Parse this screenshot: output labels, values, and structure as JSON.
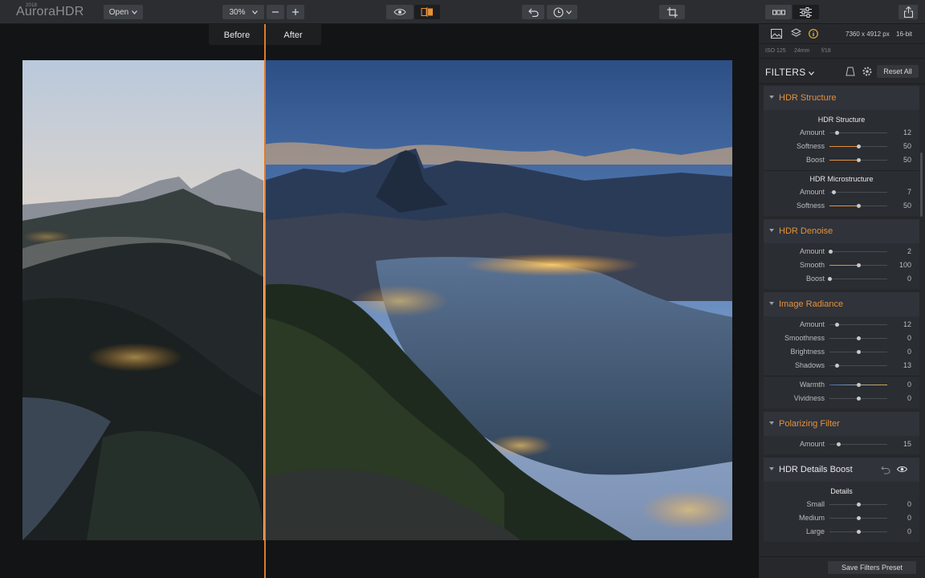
{
  "app": {
    "logo_text": "AuroraHDR",
    "logo_year": "2018"
  },
  "toolbar": {
    "open_label": "Open",
    "zoom_value": "30%",
    "zoom_out_icon": "minus-icon",
    "zoom_in_icon": "plus-icon"
  },
  "canvas": {
    "before_label": "Before",
    "after_label": "After"
  },
  "info": {
    "dimensions": "7360 x 4912 px",
    "bit_depth": "16-bit",
    "iso": "ISO 125",
    "focal": "24mm",
    "aperture": "f/18"
  },
  "filters": {
    "title": "FILTERS",
    "reset_label": "Reset All",
    "save_preset_label": "Save Filters Preset",
    "accent": "#e5913a",
    "sections": [
      {
        "title": "HDR Structure",
        "groups": [
          {
            "subtitle": "HDR Structure",
            "sliders": [
              {
                "label": "Amount",
                "value": "12",
                "pos": 0.12,
                "fill": false
              },
              {
                "label": "Softness",
                "value": "50",
                "pos": 0.5,
                "fill": true
              },
              {
                "label": "Boost",
                "value": "50",
                "pos": 0.5,
                "fill": true
              }
            ]
          },
          {
            "subtitle": "HDR Microstructure",
            "sliders": [
              {
                "label": "Amount",
                "value": "7",
                "pos": 0.07,
                "fill": false
              },
              {
                "label": "Softness",
                "value": "50",
                "pos": 0.5,
                "fill": true
              }
            ]
          }
        ]
      },
      {
        "title": "HDR Denoise",
        "groups": [
          {
            "subtitle": "",
            "sliders": [
              {
                "label": "Amount",
                "value": "2",
                "pos": 0.02,
                "fill": false
              },
              {
                "label": "Smooth",
                "value": "100",
                "pos": 0.5,
                "fill": true
              },
              {
                "label": "Boost",
                "value": "0",
                "pos": 0.0,
                "fill": false
              }
            ]
          }
        ]
      },
      {
        "title": "Image Radiance",
        "groups": [
          {
            "subtitle": "",
            "sliders": [
              {
                "label": "Amount",
                "value": "12",
                "pos": 0.12,
                "fill": false
              },
              {
                "label": "Smoothness",
                "value": "0",
                "pos": 0.5,
                "fill": false
              },
              {
                "label": "Brightness",
                "value": "0",
                "pos": 0.5,
                "fill": false
              },
              {
                "label": "Shadows",
                "value": "13",
                "pos": 0.13,
                "fill": false
              }
            ]
          },
          {
            "subtitle": "",
            "sliders": [
              {
                "label": "Warmth",
                "value": "0",
                "pos": 0.5,
                "fill": false,
                "gradient": true
              },
              {
                "label": "Vividness",
                "value": "0",
                "pos": 0.5,
                "fill": false
              }
            ]
          }
        ]
      },
      {
        "title": "Polarizing Filter",
        "groups": [
          {
            "subtitle": "",
            "sliders": [
              {
                "label": "Amount",
                "value": "15",
                "pos": 0.15,
                "fill": false
              }
            ]
          }
        ]
      },
      {
        "title": "HDR Details Boost",
        "white": true,
        "groups": [
          {
            "subtitle": "Details",
            "sliders": [
              {
                "label": "Small",
                "value": "0",
                "pos": 0.5,
                "fill": false
              },
              {
                "label": "Medium",
                "value": "0",
                "pos": 0.5,
                "fill": false
              },
              {
                "label": "Large",
                "value": "0",
                "pos": 0.5,
                "fill": false
              }
            ]
          }
        ]
      }
    ]
  }
}
